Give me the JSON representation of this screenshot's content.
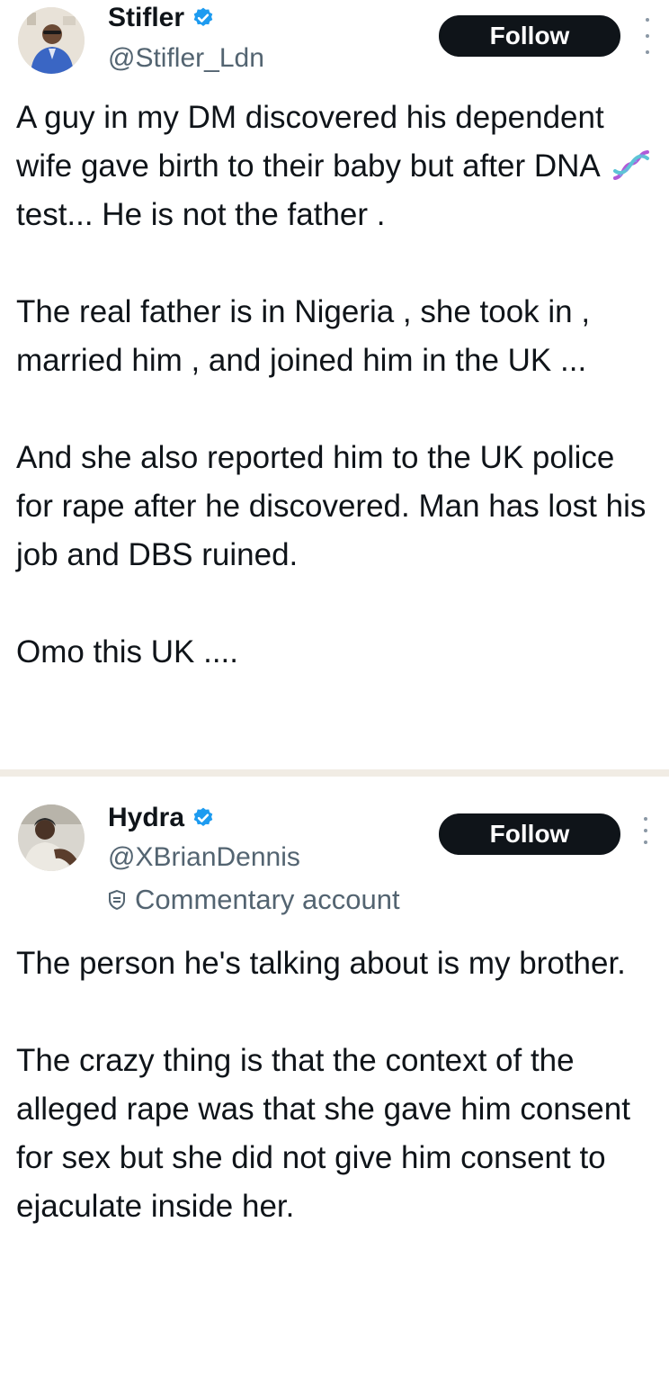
{
  "colors": {
    "verified_badge": "#1d9bf0",
    "follow_button_bg": "#0f1419",
    "handle_text": "#536471",
    "divider": "#f1ece4"
  },
  "tweets": [
    {
      "author": {
        "name": "Stifler",
        "handle": "@Stifler_Ldn",
        "verified": true,
        "avatar_icon": "user-photo-avatar"
      },
      "follow_label": "Follow",
      "paragraphs": [
        {
          "before": "A guy in my DM discovered his dependent wife gave birth to their baby but after DNA",
          "icon": "dna-icon",
          "after": "test... He is not the father ."
        },
        {
          "text": "The real father is in Nigeria , she took in , married him , and joined him in the UK ..."
        },
        {
          "text": "And she also reported him to the UK police for rape after he discovered. Man has lost his job and DBS ruined."
        },
        {
          "text": "Omo this UK ...."
        }
      ]
    },
    {
      "author": {
        "name": "Hydra",
        "handle": "@XBrianDennis",
        "verified": true,
        "avatar_icon": "user-photo-avatar",
        "label_icon": "shield-badge-icon",
        "label": "Commentary account"
      },
      "follow_label": "Follow",
      "paragraphs": [
        {
          "text": "The person he's talking about is my brother."
        },
        {
          "text": "The crazy thing is that the context of the alleged rape was that she gave him consent for sex but she did not give him consent to ejaculate inside her."
        }
      ]
    }
  ]
}
